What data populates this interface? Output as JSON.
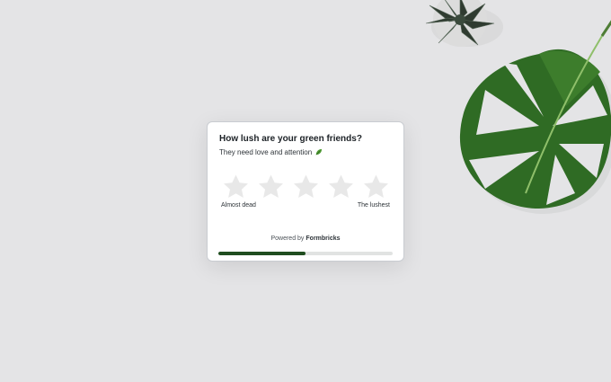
{
  "survey": {
    "question": "How lush are your green friends?",
    "subtitle": "They need love and attention",
    "subtitle_icon": "leaf-icon",
    "rating": {
      "max": 5,
      "selected": 0,
      "icon": "star-icon",
      "low_label": "Almost dead",
      "high_label": "The lushest"
    },
    "branding": {
      "prefix": "Powered by ",
      "name": "Formbricks"
    },
    "progress": 0.5
  },
  "colors": {
    "background": "#e4e4e6",
    "card": "#ffffff",
    "star_empty": "#e8e8e8",
    "progress_fill": "#1f4d1f",
    "progress_track": "#e1e3e2"
  }
}
